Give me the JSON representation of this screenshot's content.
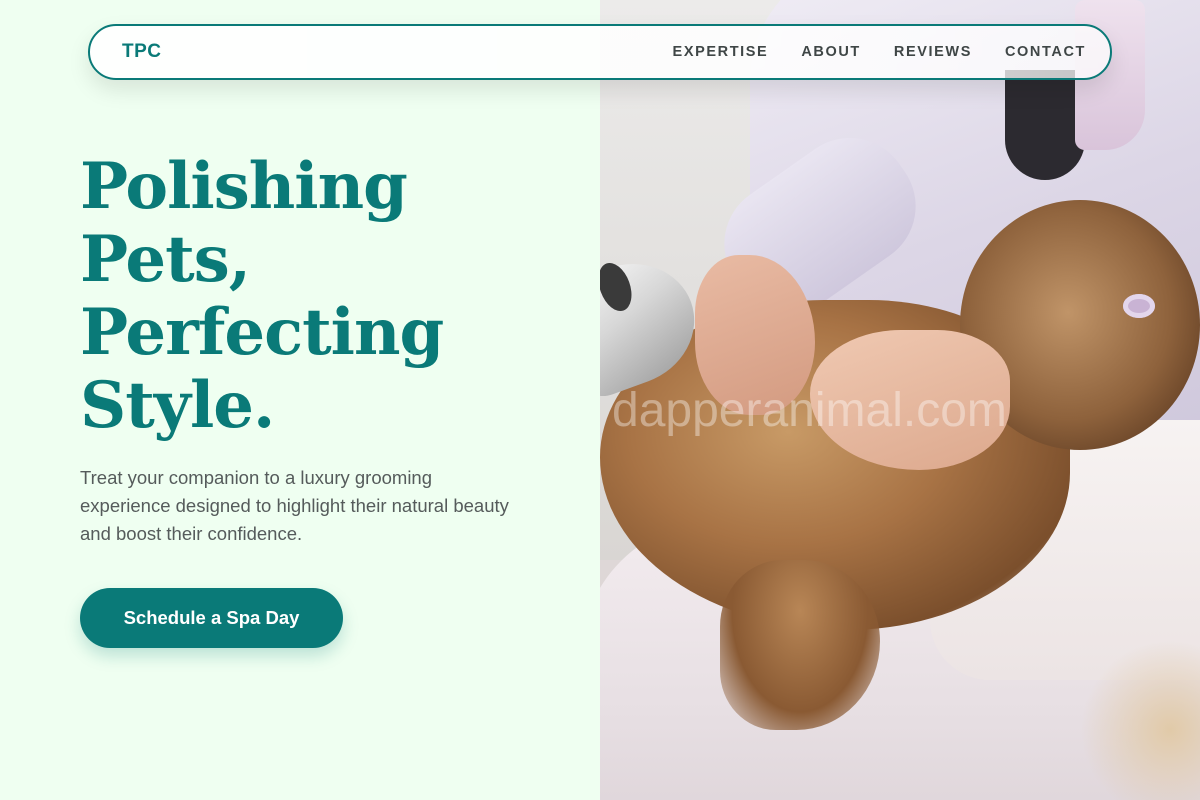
{
  "nav": {
    "logo": "TPC",
    "links": [
      "EXPERTISE",
      "ABOUT",
      "REVIEWS",
      "CONTACT"
    ]
  },
  "hero": {
    "title_lines": [
      "Polishing",
      "Pets,",
      "Perfecting",
      "Style."
    ],
    "subtitle": "Treat your companion to a luxury grooming experience designed to highlight their natural beauty and boost their confidence.",
    "cta_label": "Schedule a Spa Day"
  },
  "photo": {
    "watermark": "dapperanimal.com"
  },
  "colors": {
    "accent": "#0a7a78",
    "background": "#effff1",
    "body_text": "#555b5b",
    "nav_text": "#3f4646"
  }
}
